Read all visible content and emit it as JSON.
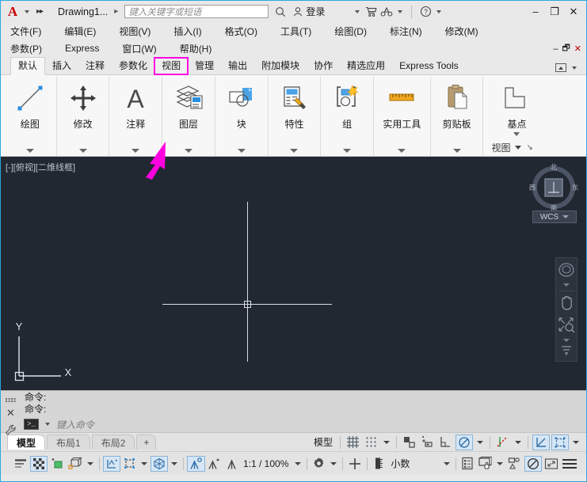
{
  "window": {
    "title": "Drawing1...",
    "logo_letter": "A",
    "minimize": "–",
    "maximize": "❐",
    "close": "✕",
    "inner_minimize": "–",
    "inner_restore": "🗗",
    "inner_close": "✕"
  },
  "quick_access": {
    "overflow_label": "▸▸",
    "separator": "▸"
  },
  "search": {
    "placeholder": "键入关键字或短语",
    "icon": "search-icon"
  },
  "account": {
    "label": "登录",
    "icon": "user-icon",
    "cart_icon": "cart-icon",
    "share_icon": "share-icon",
    "help_icon": "help-icon"
  },
  "menus": {
    "row1": [
      {
        "label": "文件(F)"
      },
      {
        "label": "编辑(E)"
      },
      {
        "label": "视图(V)"
      },
      {
        "label": "插入(I)"
      },
      {
        "label": "格式(O)"
      },
      {
        "label": "工具(T)"
      },
      {
        "label": "绘图(D)"
      },
      {
        "label": "标注(N)"
      },
      {
        "label": "修改(M)"
      }
    ],
    "row2": [
      {
        "label": "参数(P)"
      },
      {
        "label": "Express"
      },
      {
        "label": "窗口(W)"
      },
      {
        "label": "帮助(H)"
      }
    ]
  },
  "ribbon_tabs": [
    {
      "label": "默认",
      "state": "active"
    },
    {
      "label": "插入",
      "state": "normal"
    },
    {
      "label": "注释",
      "state": "normal"
    },
    {
      "label": "参数化",
      "state": "normal"
    },
    {
      "label": "视图",
      "state": "highlighted"
    },
    {
      "label": "管理",
      "state": "normal"
    },
    {
      "label": "输出",
      "state": "normal"
    },
    {
      "label": "附加模块",
      "state": "normal"
    },
    {
      "label": "协作",
      "state": "normal"
    },
    {
      "label": "精选应用",
      "state": "normal"
    },
    {
      "label": "Express Tools",
      "state": "normal"
    }
  ],
  "ribbon_panels": [
    {
      "label": "绘图",
      "icon": "line-icon"
    },
    {
      "label": "修改",
      "icon": "move-icon"
    },
    {
      "label": "注释",
      "icon": "text-a-icon"
    },
    {
      "label": "图层",
      "icon": "layers-icon"
    },
    {
      "label": "块",
      "icon": "block-icon"
    },
    {
      "label": "特性",
      "icon": "properties-icon"
    },
    {
      "label": "组",
      "icon": "group-icon"
    },
    {
      "label": "实用工具",
      "icon": "ruler-icon"
    },
    {
      "label": "剪贴板",
      "icon": "clipboard-icon"
    },
    {
      "label": "基点",
      "icon": "basepoint-icon"
    }
  ],
  "ribbon_footer": {
    "label": "视图"
  },
  "annotation": {
    "target_tab": "视图",
    "highlight_color": "#ff00e0",
    "arrow_color": "#ff00e0"
  },
  "canvas": {
    "viewport_label": "[-][俯视][二维线框]",
    "background_color": "#222831",
    "crosshair_color": "#d8dde2",
    "ucs": {
      "x_label": "X",
      "y_label": "Y"
    },
    "viewcube": {
      "north": "北",
      "south": "南",
      "east": "东",
      "west": "西",
      "coord_system": "WCS"
    },
    "navbar_icons": [
      "steering-wheel-icon",
      "pan-hand-icon",
      "zoom-extents-icon",
      "orbit-icon"
    ]
  },
  "command_line": {
    "history": [
      "命令:",
      "命令:"
    ],
    "input_placeholder": "键入命令",
    "prompt_glyph": ">_",
    "close_icon": "close-icon",
    "customize_icon": "wrench-icon",
    "grip_icon": "grip-icon"
  },
  "layout_tabs": [
    {
      "label": "模型",
      "active": true
    },
    {
      "label": "布局1",
      "active": false
    },
    {
      "label": "布局2",
      "active": false
    },
    {
      "label": "+",
      "active": false
    }
  ],
  "status_row_upper": {
    "space_label": "模型",
    "items": [
      {
        "name": "grid-display-toggle",
        "icon": "grid-icon",
        "active": false
      },
      {
        "name": "snap-mode-toggle",
        "icon": "snap-dots-icon",
        "active": false
      },
      {
        "name": "ortho-mode-toggle",
        "icon": "ortho-icon",
        "active": false
      },
      {
        "name": "polar-tracking-toggle",
        "icon": "polar-icon",
        "active": false
      },
      {
        "name": "isometric-draft-toggle",
        "icon": "isodraft-icon",
        "active": false
      },
      {
        "name": "object-snap-toggle",
        "icon": "osnap-circle-icon",
        "active": true
      },
      {
        "name": "object-snap-tracking-toggle",
        "icon": "otrack-icon",
        "active": false
      },
      {
        "name": "dynamic-ucs-toggle",
        "icon": "dynamic-ucs-icon",
        "active": true
      },
      {
        "name": "dynamic-input-toggle",
        "icon": "dyninput-icon",
        "active": true
      }
    ]
  },
  "status_row_lower": {
    "scale_label": "1:1 / 100%",
    "units_label": "小数",
    "items": [
      {
        "name": "lineweight-toggle",
        "icon": "lineweight-icon",
        "active": false
      },
      {
        "name": "transparency-toggle",
        "icon": "transparency-icon",
        "active": true
      },
      {
        "name": "selection-cycling-toggle",
        "icon": "selection-cycling-icon",
        "active": false
      },
      {
        "name": "3d-object-snap-toggle",
        "icon": "osnap3d-icon",
        "active": false
      },
      {
        "name": "annotation-visibility-toggle",
        "icon": "annot-visibility-icon",
        "active": true
      },
      {
        "name": "autoscale-toggle",
        "icon": "autoscale-icon",
        "active": false
      },
      {
        "name": "annotation-scale-toggle",
        "icon": "annot-scale-icon",
        "active": true
      },
      {
        "name": "workspace-switch",
        "icon": "gear-icon",
        "active": false
      },
      {
        "name": "hardware-accel-toggle",
        "icon": "plus-icon",
        "active": false
      },
      {
        "name": "units-icon",
        "icon": "units-icon",
        "active": false
      },
      {
        "name": "quick-properties-toggle",
        "icon": "quickprops-icon",
        "active": false
      },
      {
        "name": "isolate-objects-toggle",
        "icon": "isolate-icon",
        "active": false
      },
      {
        "name": "graphics-perf-toggle",
        "icon": "graphics-perf-icon",
        "active": false
      },
      {
        "name": "clean-screen-toggle",
        "icon": "clean-screen-icon",
        "active": true
      },
      {
        "name": "fullscreen-toggle",
        "icon": "fullscreen-icon",
        "active": false
      },
      {
        "name": "customization-menu",
        "icon": "hamburger-icon",
        "active": false
      }
    ]
  }
}
